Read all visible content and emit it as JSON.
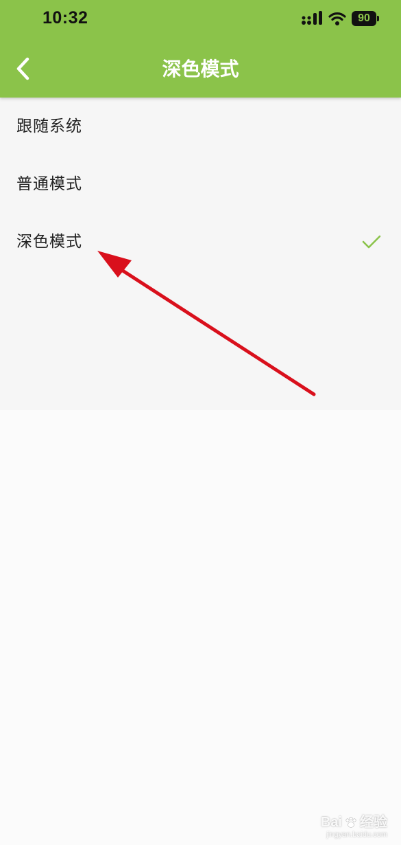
{
  "status_bar": {
    "time": "10:32",
    "battery": "90"
  },
  "header": {
    "title": "深色模式",
    "back_icon": "chevron-left-icon"
  },
  "options": [
    {
      "label": "跟随系统",
      "selected": false
    },
    {
      "label": "普通模式",
      "selected": false
    },
    {
      "label": "深色模式",
      "selected": true
    }
  ],
  "watermark": {
    "logo_text": "Bai",
    "logo_suffix": "经验",
    "url": "jingyan.baidu.com"
  },
  "colors": {
    "accent": "#8bc34a",
    "arrow": "#d9101c"
  }
}
